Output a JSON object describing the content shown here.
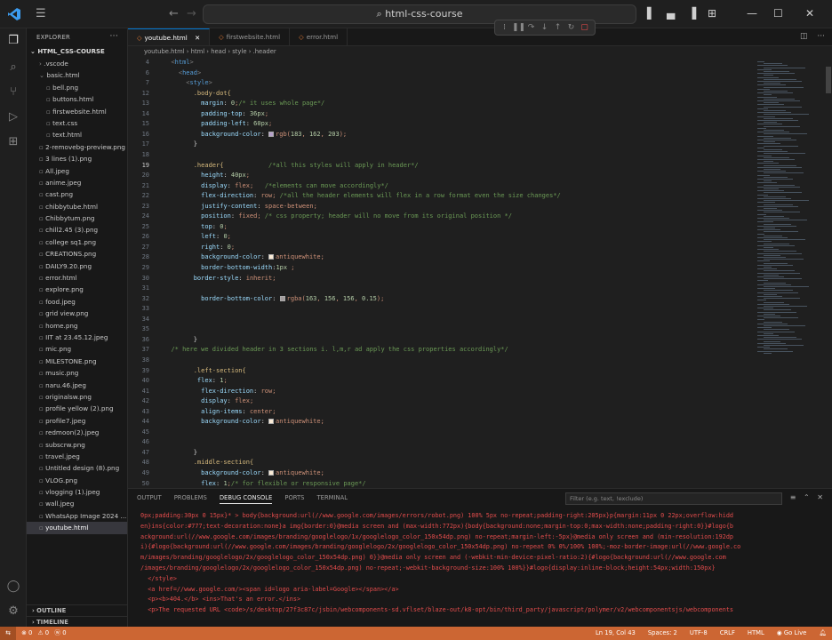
{
  "titlebar": {
    "search_text": "html-css-course",
    "search_icon": "search-icon",
    "debug_icons": [
      "drag-handle-icon",
      "pause-icon",
      "step-over-icon",
      "step-into-icon",
      "step-out-icon",
      "restart-icon",
      "stop-icon"
    ]
  },
  "sidebar": {
    "header": "EXPLORER",
    "folder": "HTML_CSS-COURSE",
    "files": [
      {
        "name": ".vscode",
        "indent": 1,
        "type": "folder-closed"
      },
      {
        "name": "basic.html",
        "indent": 1,
        "type": "folder-open"
      },
      {
        "name": "bell.png",
        "indent": 2,
        "type": "file"
      },
      {
        "name": "buttons.html",
        "indent": 2,
        "type": "file"
      },
      {
        "name": "firstwebsite.html",
        "indent": 2,
        "type": "file"
      },
      {
        "name": "text.css",
        "indent": 2,
        "type": "file"
      },
      {
        "name": "text.html",
        "indent": 2,
        "type": "file"
      },
      {
        "name": "2-removebg-preview.png",
        "indent": 1,
        "type": "file"
      },
      {
        "name": "3 lines (1).png",
        "indent": 1,
        "type": "file"
      },
      {
        "name": "All.jpeg",
        "indent": 1,
        "type": "file"
      },
      {
        "name": "anime.jpeg",
        "indent": 1,
        "type": "file"
      },
      {
        "name": "cast.png",
        "indent": 1,
        "type": "file"
      },
      {
        "name": "chibbytube.html",
        "indent": 1,
        "type": "file"
      },
      {
        "name": "Chibbytum.png",
        "indent": 1,
        "type": "file"
      },
      {
        "name": "chill2.45 (3).png",
        "indent": 1,
        "type": "file"
      },
      {
        "name": "college sq1.png",
        "indent": 1,
        "type": "file"
      },
      {
        "name": "CREATIONS.png",
        "indent": 1,
        "type": "file"
      },
      {
        "name": "DAILY9.20.png",
        "indent": 1,
        "type": "file"
      },
      {
        "name": "error.html",
        "indent": 1,
        "type": "file"
      },
      {
        "name": "explore.png",
        "indent": 1,
        "type": "file"
      },
      {
        "name": "food.jpeg",
        "indent": 1,
        "type": "file"
      },
      {
        "name": "grid view.png",
        "indent": 1,
        "type": "file"
      },
      {
        "name": "home.png",
        "indent": 1,
        "type": "file"
      },
      {
        "name": "IIT at 23.45.12.jpeg",
        "indent": 1,
        "type": "file"
      },
      {
        "name": "mic.png",
        "indent": 1,
        "type": "file"
      },
      {
        "name": "MILESTONE.png",
        "indent": 1,
        "type": "file"
      },
      {
        "name": "music.png",
        "indent": 1,
        "type": "file"
      },
      {
        "name": "naru.46.jpeg",
        "indent": 1,
        "type": "file"
      },
      {
        "name": "originalsw.png",
        "indent": 1,
        "type": "file"
      },
      {
        "name": "profile yellow (2).png",
        "indent": 1,
        "type": "file"
      },
      {
        "name": "profile7.jpeg",
        "indent": 1,
        "type": "file"
      },
      {
        "name": "redmoon(2).jpeg",
        "indent": 1,
        "type": "file"
      },
      {
        "name": "subscrw.png",
        "indent": 1,
        "type": "file"
      },
      {
        "name": "travel.jpeg",
        "indent": 1,
        "type": "file"
      },
      {
        "name": "Untitled design (8).png",
        "indent": 1,
        "type": "file"
      },
      {
        "name": "VLOG.png",
        "indent": 1,
        "type": "file"
      },
      {
        "name": "vlogging (1).jpeg",
        "indent": 1,
        "type": "file"
      },
      {
        "name": "wall.jpeg",
        "indent": 1,
        "type": "file"
      },
      {
        "name": "WhatsApp Image 2024 ...",
        "indent": 1,
        "type": "file"
      },
      {
        "name": "youtube.html",
        "indent": 1,
        "type": "file",
        "active": true
      }
    ],
    "outline": "OUTLINE",
    "timeline": "TIMELINE"
  },
  "tabs": [
    {
      "label": "youtube.html",
      "active": true
    },
    {
      "label": "firstwebsite.html",
      "active": false
    },
    {
      "label": "error.html",
      "active": false
    }
  ],
  "breadcrumb": [
    "youtube.html",
    "html",
    "head",
    "style",
    ".header"
  ],
  "editor": {
    "current_line": "19",
    "lines": [
      {
        "n": "4",
        "code": "  <html>"
      },
      {
        "n": "6",
        "code": "    <head>"
      },
      {
        "n": "7",
        "code": "      <style>"
      },
      {
        "n": "12",
        "code": "        .body-dot{"
      },
      {
        "n": "13",
        "code": "          margin: 0;/* it uses whole page*/"
      },
      {
        "n": "14",
        "code": "          padding-top: 36px;"
      },
      {
        "n": "15",
        "code": "          padding-left: 60px;"
      },
      {
        "n": "16",
        "code": "          background-color: ■rgb(183, 162, 203);"
      },
      {
        "n": "17",
        "code": "        }"
      },
      {
        "n": "18",
        "code": ""
      },
      {
        "n": "19",
        "code": "        .header{            /*all this styles will apply in header*/"
      },
      {
        "n": "20",
        "code": "          height: 40px;"
      },
      {
        "n": "21",
        "code": "          display: flex;   /*elements can move accordingly*/"
      },
      {
        "n": "22",
        "code": "          flex-direction: row; /*all the header elements will flex in a row format even the size changes*/"
      },
      {
        "n": "23",
        "code": "          justify-content: space-between;"
      },
      {
        "n": "24",
        "code": "          position: fixed; /* css property; header will no move from its original position */"
      },
      {
        "n": "25",
        "code": "          top: 0;"
      },
      {
        "n": "26",
        "code": "          left: 0;"
      },
      {
        "n": "27",
        "code": "          right: 0;"
      },
      {
        "n": "28",
        "code": "          background-color: ■antiquewhite;"
      },
      {
        "n": "29",
        "code": "          border-bottom-width:1px ;"
      },
      {
        "n": "30",
        "code": "        border-style: inherit;"
      },
      {
        "n": "31",
        "code": ""
      },
      {
        "n": "32",
        "code": "          border-bottom-color: ■rgba(163, 156, 156, 0.15);"
      },
      {
        "n": "33",
        "code": ""
      },
      {
        "n": "34",
        "code": ""
      },
      {
        "n": "35",
        "code": ""
      },
      {
        "n": "36",
        "code": "        }"
      },
      {
        "n": "37",
        "code": "  /* here we divided header in 3 sections i. l,m,r ad apply the css properties accordingly*/"
      },
      {
        "n": "38",
        "code": ""
      },
      {
        "n": "39",
        "code": "        .left-section{"
      },
      {
        "n": "40",
        "code": "         flex: 1;"
      },
      {
        "n": "41",
        "code": "          flex-direction: row;"
      },
      {
        "n": "42",
        "code": "          display: flex;"
      },
      {
        "n": "43",
        "code": "          align-items: center;"
      },
      {
        "n": "44",
        "code": "          background-color: ■antiquewhite;"
      },
      {
        "n": "45",
        "code": ""
      },
      {
        "n": "46",
        "code": ""
      },
      {
        "n": "47",
        "code": "        }"
      },
      {
        "n": "48",
        "code": "        .middle-section{"
      },
      {
        "n": "49",
        "code": "          background-color: ■antiquewhite;"
      },
      {
        "n": "50",
        "code": "          flex: 1;/* for flexible or responsive page*/"
      }
    ]
  },
  "panel": {
    "tabs": [
      "OUTPUT",
      "PROBLEMS",
      "DEBUG CONSOLE",
      "PORTS",
      "TERMINAL"
    ],
    "active_tab": "DEBUG CONSOLE",
    "filter_placeholder": "Filter (e.g. text, !exclude)",
    "console_lines": [
      "0px;padding:30px 0 15px}* > body{background:url(//www.google.com/images/errors/robot.png) 100% 5px no-repeat;padding-right:205px}p{margin:11px 0 22px;overflow:hidd",
      "en}ins{color:#777;text-decoration:none}a img{border:0}@media screen and (max-width:772px){body{background:none;margin-top:0;max-width:none;padding-right:0}}#logo{b",
      "ackground:url(//www.google.com/images/branding/googlelogo/1x/googlelogo_color_150x54dp.png) no-repeat;margin-left:-5px}@media only screen and (min-resolution:192dp",
      "i){#logo{background:url(//www.google.com/images/branding/googlelogo/2x/googlelogo_color_150x54dp.png) no-repeat 0% 0%/100% 100%;-moz-border-image:url(//www.google.co",
      "m/images/branding/googlelogo/2x/googlelogo_color_150x54dp.png) 0}}@media only screen and (-webkit-min-device-pixel-ratio:2){#logo{background:url(//www.google.com",
      "/images/branding/googlelogo/2x/googlelogo_color_150x54dp.png) no-repeat;-webkit-background-size:100% 100%}}#logo{display:inline-block;height:54px;width:150px}",
      "  </style>",
      "  <a href=//www.google.com/><span id=logo aria-label=Google></span></a>",
      "  <p><b>404.</b> <ins>That's an error.</ins>",
      "  <p>The requested URL <code>/s/desktop/27f3c87c/jsbin/webcomponents-sd.vflset/blaze-out/k8-opt/bin/third_party/javascript/polymer/v2/webcomponentsjs/webcomponents"
    ]
  },
  "statusbar": {
    "errors": "⊗ 0",
    "warnings": "⚠ 0",
    "extra": "ⓦ 0",
    "position": "Ln 19, Col 43",
    "spaces": "Spaces: 2",
    "encoding": "UTF-8",
    "eol": "CRLF",
    "language": "HTML",
    "golive": "Go Live"
  },
  "colors": {
    "statusbar": "#cc6633",
    "accent": "#0078d4",
    "swatch_lavender": "#b7a2cb",
    "swatch_antiquewhite": "#faebd7",
    "swatch_rgba": "#a39c9c"
  }
}
